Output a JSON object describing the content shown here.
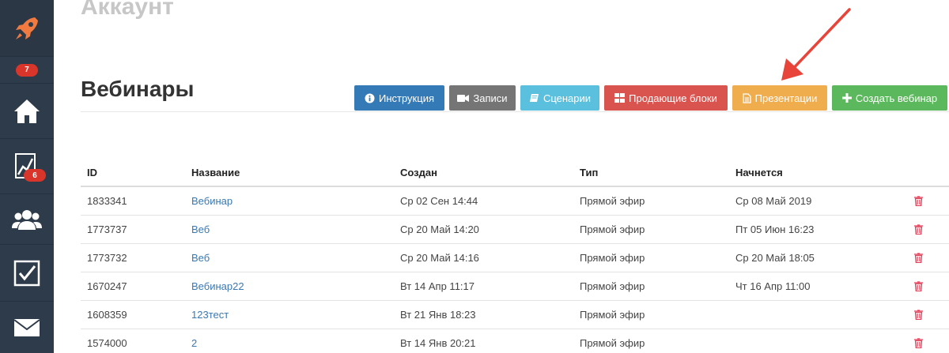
{
  "sidebar": {
    "items": [
      {
        "icon": "rocket-icon"
      },
      {
        "icon": "badge-icon",
        "badge": "7"
      },
      {
        "icon": "home-icon"
      },
      {
        "icon": "chart-icon",
        "badge": "6"
      },
      {
        "icon": "users-icon"
      },
      {
        "icon": "checkbox-icon"
      },
      {
        "icon": "mail-icon"
      }
    ]
  },
  "header": {
    "page_title": "Аккаунт",
    "section_title": "Вебинары"
  },
  "toolbar": {
    "instruction": "Инструкция",
    "records": "Записи",
    "scenarios": "Сценарии",
    "selling_blocks": "Продающие блоки",
    "presentations": "Презентации",
    "create": "Создать вебинар"
  },
  "table": {
    "headers": {
      "id": "ID",
      "name": "Название",
      "created": "Создан",
      "type": "Тип",
      "starts": "Начнется"
    },
    "rows": [
      {
        "id": "1833341",
        "name": "Вебинар",
        "created": "Ср 02 Сен 14:44",
        "type": "Прямой эфир",
        "starts": "Ср 08 Май 2019"
      },
      {
        "id": "1773737",
        "name": "Веб",
        "created": "Ср 20 Май 14:20",
        "type": "Прямой эфир",
        "starts": "Пт 05 Июн 16:23"
      },
      {
        "id": "1773732",
        "name": "Веб",
        "created": "Ср 20 Май 14:16",
        "type": "Прямой эфир",
        "starts": "Ср 20 Май 18:05"
      },
      {
        "id": "1670247",
        "name": "Вебинар22",
        "created": "Вт 14 Апр 11:17",
        "type": "Прямой эфир",
        "starts": "Чт 16 Апр 11:00"
      },
      {
        "id": "1608359",
        "name": "123тест",
        "created": "Вт 21 Янв 18:23",
        "type": "Прямой эфир",
        "starts": ""
      },
      {
        "id": "1574000",
        "name": "2",
        "created": "Вт 14 Янв 20:21",
        "type": "Прямой эфир",
        "starts": ""
      }
    ]
  },
  "colors": {
    "sidebar_bg": "#2e3b4a",
    "rocket": "#f07a3f",
    "badge": "#d9352b",
    "link": "#3a78b3",
    "trash": "#e0405a",
    "arrow": "#e8443a"
  }
}
